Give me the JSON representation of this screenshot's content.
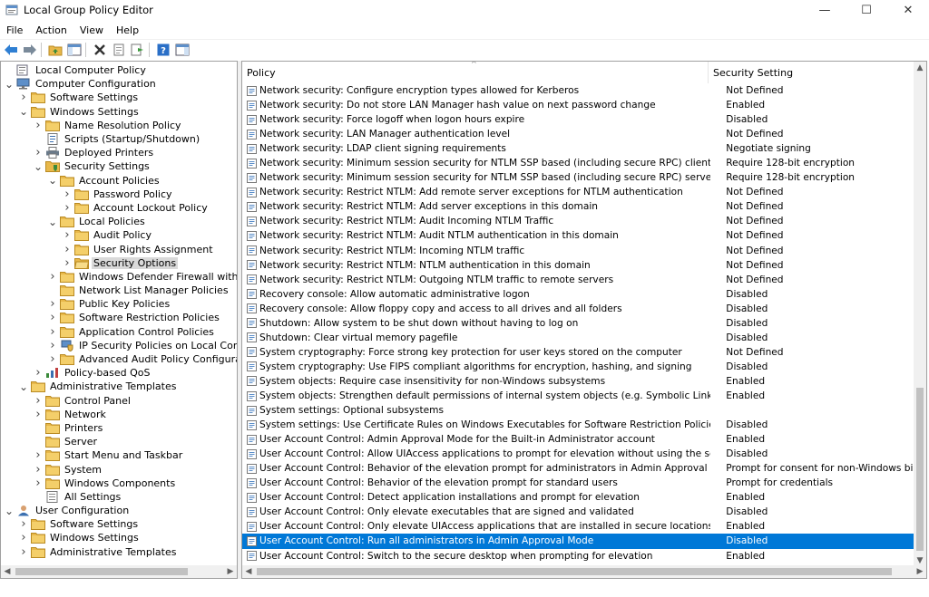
{
  "window": {
    "title": "Local Group Policy Editor",
    "minimize_glyph": "—",
    "maximize_glyph": "☐",
    "close_glyph": "✕"
  },
  "menu": [
    "File",
    "Action",
    "View",
    "Help"
  ],
  "tree": [
    {
      "label": "Local Computer Policy",
      "level": 0,
      "expander": "none",
      "icon": "computer-policy-icon"
    },
    {
      "label": "Computer Configuration",
      "level": 0,
      "expander": "open",
      "icon": "computer-icon"
    },
    {
      "label": "Software Settings",
      "level": 1,
      "expander": "closed",
      "icon": "folder-icon"
    },
    {
      "label": "Windows Settings",
      "level": 1,
      "expander": "open",
      "icon": "folder-icon"
    },
    {
      "label": "Name Resolution Policy",
      "level": 2,
      "expander": "closed",
      "icon": "folder-icon"
    },
    {
      "label": "Scripts (Startup/Shutdown)",
      "level": 2,
      "expander": "none",
      "icon": "script-icon"
    },
    {
      "label": "Deployed Printers",
      "level": 2,
      "expander": "closed",
      "icon": "printer-icon"
    },
    {
      "label": "Security Settings",
      "level": 2,
      "expander": "open",
      "icon": "security-icon"
    },
    {
      "label": "Account Policies",
      "level": 3,
      "expander": "open",
      "icon": "folder-icon"
    },
    {
      "label": "Password Policy",
      "level": 4,
      "expander": "closed",
      "icon": "folder-icon"
    },
    {
      "label": "Account Lockout Policy",
      "level": 4,
      "expander": "closed",
      "icon": "folder-icon"
    },
    {
      "label": "Local Policies",
      "level": 3,
      "expander": "open",
      "icon": "folder-icon"
    },
    {
      "label": "Audit Policy",
      "level": 4,
      "expander": "closed",
      "icon": "folder-icon"
    },
    {
      "label": "User Rights Assignment",
      "level": 4,
      "expander": "closed",
      "icon": "folder-icon"
    },
    {
      "label": "Security Options",
      "level": 4,
      "expander": "closed",
      "icon": "folder-open-icon",
      "selected": true
    },
    {
      "label": "Windows Defender Firewall with Advanc",
      "level": 3,
      "expander": "closed",
      "icon": "folder-icon"
    },
    {
      "label": "Network List Manager Policies",
      "level": 3,
      "expander": "none",
      "icon": "folder-icon"
    },
    {
      "label": "Public Key Policies",
      "level": 3,
      "expander": "closed",
      "icon": "folder-icon"
    },
    {
      "label": "Software Restriction Policies",
      "level": 3,
      "expander": "closed",
      "icon": "folder-icon"
    },
    {
      "label": "Application Control Policies",
      "level": 3,
      "expander": "closed",
      "icon": "folder-icon"
    },
    {
      "label": "IP Security Policies on Local Computer",
      "level": 3,
      "expander": "closed",
      "icon": "ipsec-icon"
    },
    {
      "label": "Advanced Audit Policy Configuration",
      "level": 3,
      "expander": "closed",
      "icon": "folder-icon"
    },
    {
      "label": "Policy-based QoS",
      "level": 2,
      "expander": "closed",
      "icon": "chart-icon"
    },
    {
      "label": "Administrative Templates",
      "level": 1,
      "expander": "open",
      "icon": "folder-icon"
    },
    {
      "label": "Control Panel",
      "level": 2,
      "expander": "closed",
      "icon": "folder-icon"
    },
    {
      "label": "Network",
      "level": 2,
      "expander": "closed",
      "icon": "folder-icon"
    },
    {
      "label": "Printers",
      "level": 2,
      "expander": "none",
      "icon": "folder-icon"
    },
    {
      "label": "Server",
      "level": 2,
      "expander": "none",
      "icon": "folder-icon"
    },
    {
      "label": "Start Menu and Taskbar",
      "level": 2,
      "expander": "closed",
      "icon": "folder-icon"
    },
    {
      "label": "System",
      "level": 2,
      "expander": "closed",
      "icon": "folder-icon"
    },
    {
      "label": "Windows Components",
      "level": 2,
      "expander": "closed",
      "icon": "folder-icon"
    },
    {
      "label": "All Settings",
      "level": 2,
      "expander": "none",
      "icon": "settings-icon"
    },
    {
      "label": "User Configuration",
      "level": 0,
      "expander": "open",
      "icon": "user-icon"
    },
    {
      "label": "Software Settings",
      "level": 1,
      "expander": "closed",
      "icon": "folder-icon"
    },
    {
      "label": "Windows Settings",
      "level": 1,
      "expander": "closed",
      "icon": "folder-icon"
    },
    {
      "label": "Administrative Templates",
      "level": 1,
      "expander": "closed",
      "icon": "folder-icon"
    }
  ],
  "list": {
    "columns": {
      "policy": "Policy",
      "setting": "Security Setting"
    },
    "sort_glyph": "^",
    "rows": [
      {
        "policy": "Network security: Configure encryption types allowed for Kerberos",
        "setting": "Not Defined"
      },
      {
        "policy": "Network security: Do not store LAN Manager hash value on next password change",
        "setting": "Enabled"
      },
      {
        "policy": "Network security: Force logoff when logon hours expire",
        "setting": "Disabled"
      },
      {
        "policy": "Network security: LAN Manager authentication level",
        "setting": "Not Defined"
      },
      {
        "policy": "Network security: LDAP client signing requirements",
        "setting": "Negotiate signing"
      },
      {
        "policy": "Network security: Minimum session security for NTLM SSP based (including secure RPC) clients",
        "setting": "Require 128-bit encryption"
      },
      {
        "policy": "Network security: Minimum session security for NTLM SSP based (including secure RPC) servers",
        "setting": "Require 128-bit encryption"
      },
      {
        "policy": "Network security: Restrict NTLM: Add remote server exceptions for NTLM authentication",
        "setting": "Not Defined"
      },
      {
        "policy": "Network security: Restrict NTLM: Add server exceptions in this domain",
        "setting": "Not Defined"
      },
      {
        "policy": "Network security: Restrict NTLM: Audit Incoming NTLM Traffic",
        "setting": "Not Defined"
      },
      {
        "policy": "Network security: Restrict NTLM: Audit NTLM authentication in this domain",
        "setting": "Not Defined"
      },
      {
        "policy": "Network security: Restrict NTLM: Incoming NTLM traffic",
        "setting": "Not Defined"
      },
      {
        "policy": "Network security: Restrict NTLM: NTLM authentication in this domain",
        "setting": "Not Defined"
      },
      {
        "policy": "Network security: Restrict NTLM: Outgoing NTLM traffic to remote servers",
        "setting": "Not Defined"
      },
      {
        "policy": "Recovery console: Allow automatic administrative logon",
        "setting": "Disabled"
      },
      {
        "policy": "Recovery console: Allow floppy copy and access to all drives and all folders",
        "setting": "Disabled"
      },
      {
        "policy": "Shutdown: Allow system to be shut down without having to log on",
        "setting": "Disabled"
      },
      {
        "policy": "Shutdown: Clear virtual memory pagefile",
        "setting": "Disabled"
      },
      {
        "policy": "System cryptography: Force strong key protection for user keys stored on the computer",
        "setting": "Not Defined"
      },
      {
        "policy": "System cryptography: Use FIPS compliant algorithms for encryption, hashing, and signing",
        "setting": "Disabled"
      },
      {
        "policy": "System objects: Require case insensitivity for non-Windows subsystems",
        "setting": "Enabled"
      },
      {
        "policy": "System objects: Strengthen default permissions of internal system objects (e.g. Symbolic Links)",
        "setting": "Enabled"
      },
      {
        "policy": "System settings: Optional subsystems",
        "setting": ""
      },
      {
        "policy": "System settings: Use Certificate Rules on Windows Executables for Software Restriction Policies",
        "setting": "Disabled"
      },
      {
        "policy": "User Account Control: Admin Approval Mode for the Built-in Administrator account",
        "setting": "Enabled"
      },
      {
        "policy": "User Account Control: Allow UIAccess applications to prompt for elevation without using the secure desktop",
        "setting": "Disabled"
      },
      {
        "policy": "User Account Control: Behavior of the elevation prompt for administrators in Admin Approval Mode",
        "setting": "Prompt for consent for non-Windows binaries"
      },
      {
        "policy": "User Account Control: Behavior of the elevation prompt for standard users",
        "setting": "Prompt for credentials"
      },
      {
        "policy": "User Account Control: Detect application installations and prompt for elevation",
        "setting": "Enabled"
      },
      {
        "policy": "User Account Control: Only elevate executables that are signed and validated",
        "setting": "Disabled"
      },
      {
        "policy": "User Account Control: Only elevate UIAccess applications that are installed in secure locations",
        "setting": "Enabled"
      },
      {
        "policy": "User Account Control: Run all administrators in Admin Approval Mode",
        "setting": "Disabled",
        "selected": true
      },
      {
        "policy": "User Account Control: Switch to the secure desktop when prompting for elevation",
        "setting": "Enabled"
      },
      {
        "policy": "",
        "setting": ""
      }
    ]
  },
  "colors": {
    "selection": "#0078d7",
    "folder": "#e8b84a",
    "tree_selection": "#d9d9d9"
  }
}
